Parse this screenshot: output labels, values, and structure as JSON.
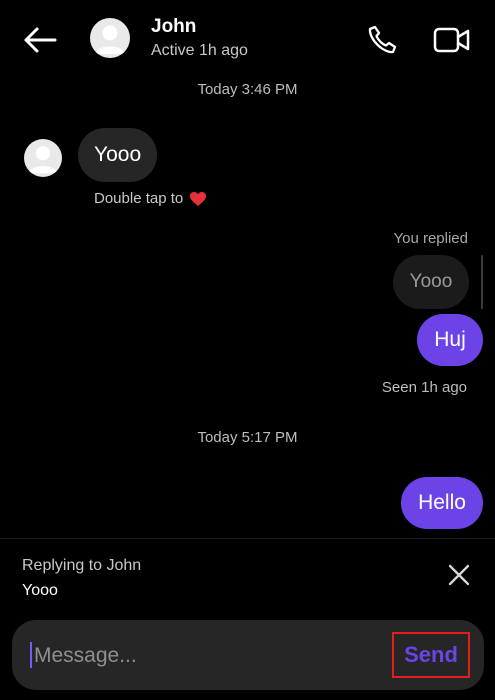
{
  "header": {
    "contact_name": "John",
    "status": "Active 1h ago",
    "icons": [
      "back-arrow-icon",
      "phone-icon",
      "video-camera-icon"
    ]
  },
  "conversation": {
    "timestamp_1": "Today 3:46 PM",
    "incoming_message": "Yooo",
    "double_tap_hint": "Double tap to",
    "you_replied_label": "You replied",
    "quoted_message": "Yooo",
    "outgoing_reply": "Huj",
    "seen_status": "Seen 1h ago",
    "timestamp_2": "Today 5:17 PM",
    "outgoing_message": "Hello"
  },
  "reply_bar": {
    "label": "Replying to John",
    "quoted_text": "Yooo"
  },
  "composer": {
    "placeholder": "Message...",
    "send_label": "Send"
  },
  "colors": {
    "accent": "#6c43e6",
    "incoming_bubble": "#262626",
    "highlight_border": "#e41e1e",
    "heart": "#e8313b"
  }
}
